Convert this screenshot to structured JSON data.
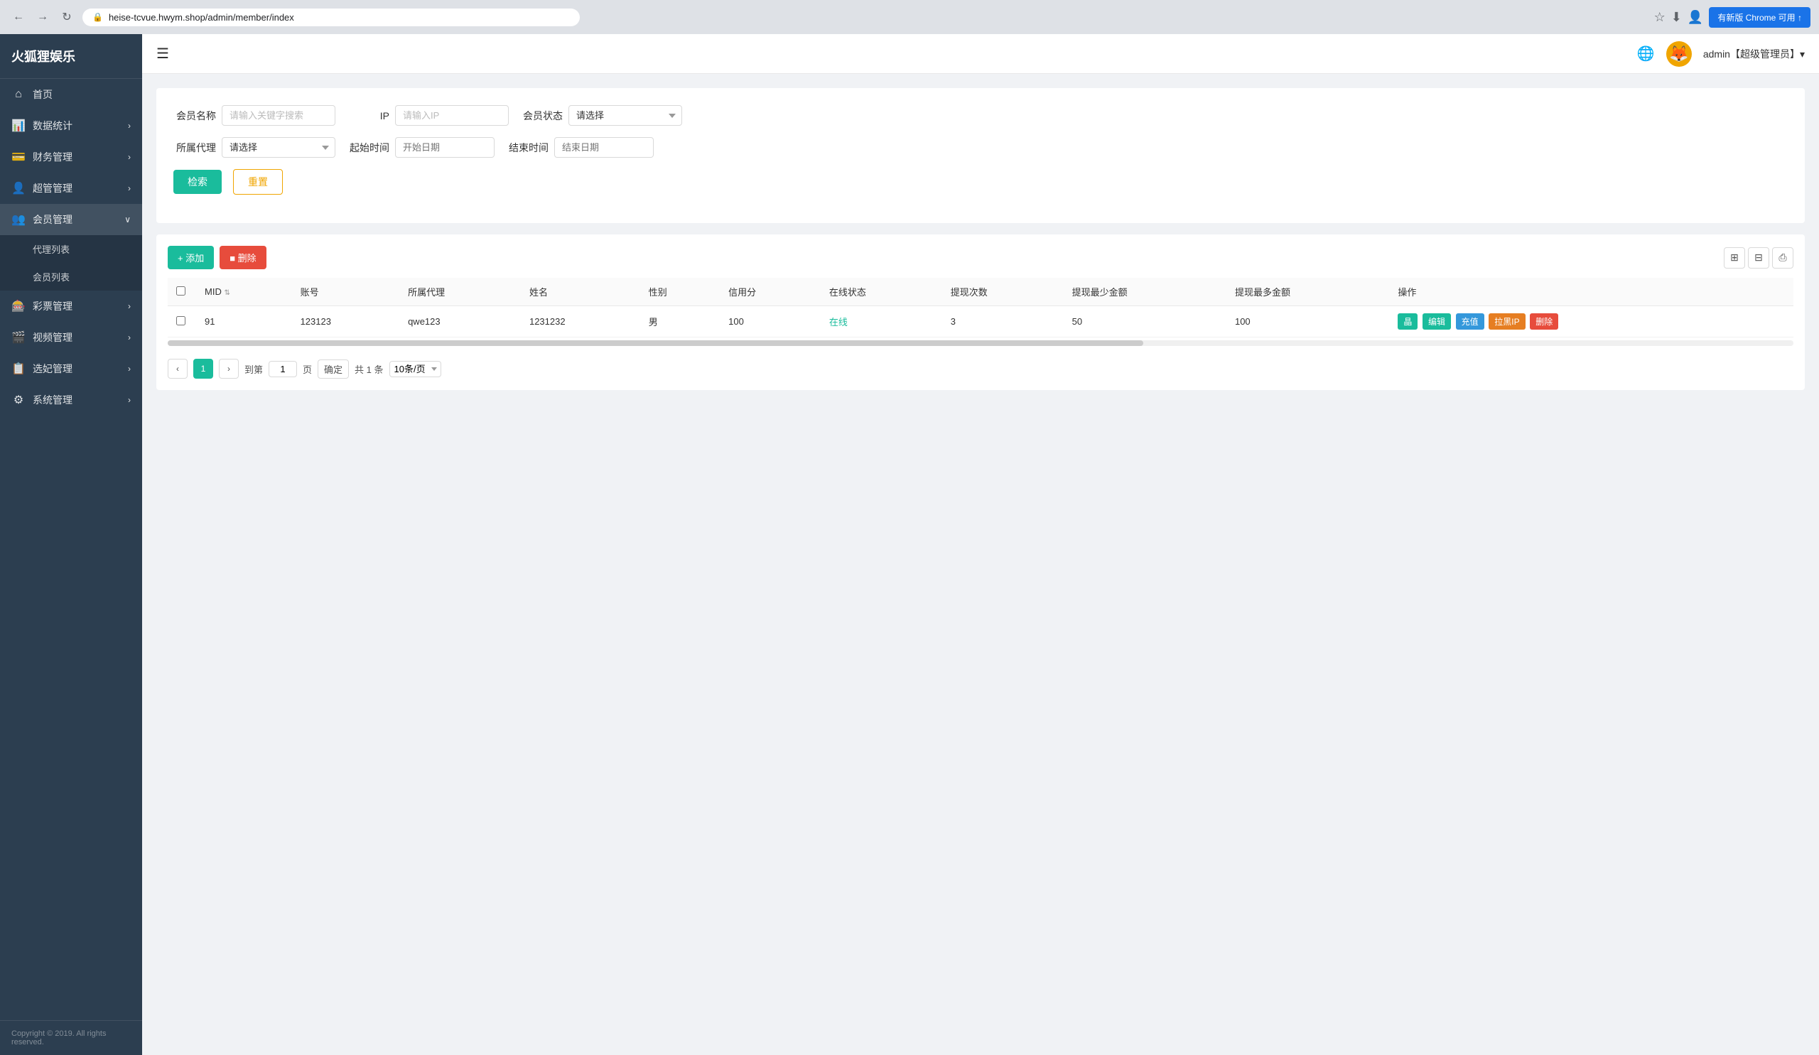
{
  "browser": {
    "url": "heise-tcvue.hwym.shop/admin/member/index",
    "update_btn": "有新版 Chrome 可用 ↑"
  },
  "sidebar": {
    "logo": "火狐狸娱乐",
    "menu_icon": "☰",
    "items": [
      {
        "id": "home",
        "icon": "⌂",
        "label": "首页",
        "hasArrow": false,
        "hasSubmenu": false
      },
      {
        "id": "data-stats",
        "icon": "📊",
        "label": "数据统计",
        "hasArrow": true,
        "hasSubmenu": false
      },
      {
        "id": "finance",
        "icon": "💳",
        "label": "财务管理",
        "hasArrow": true,
        "hasSubmenu": false
      },
      {
        "id": "super-admin",
        "icon": "👤",
        "label": "超管管理",
        "hasArrow": true,
        "hasSubmenu": false
      },
      {
        "id": "member-mgmt",
        "icon": "👥",
        "label": "会员管理",
        "hasArrow": true,
        "hasSubmenu": true,
        "submenu": [
          "代理列表",
          "会员列表"
        ]
      },
      {
        "id": "lottery",
        "icon": "🎰",
        "label": "彩票管理",
        "hasArrow": true,
        "hasSubmenu": false
      },
      {
        "id": "video",
        "icon": "🎬",
        "label": "视频管理",
        "hasArrow": true,
        "hasSubmenu": false
      },
      {
        "id": "election",
        "icon": "📋",
        "label": "选妃管理",
        "hasArrow": true,
        "hasSubmenu": false
      },
      {
        "id": "system",
        "icon": "⚙",
        "label": "系统管理",
        "hasArrow": true,
        "hasSubmenu": false
      }
    ],
    "footer": "Copyright © 2019. All rights reserved."
  },
  "header": {
    "user_label": "admin【超级管理员】▾"
  },
  "search": {
    "member_name_label": "会员名称",
    "member_name_placeholder": "请输入关键字搜索",
    "ip_label": "IP",
    "ip_placeholder": "请输入IP",
    "status_label": "会员状态",
    "status_placeholder": "请选择",
    "agent_label": "所属代理",
    "agent_placeholder": "请选择",
    "start_label": "起始时间",
    "start_placeholder": "开始日期",
    "end_label": "结束时间",
    "end_placeholder": "结束日期",
    "search_btn": "检索",
    "reset_btn": "重置"
  },
  "table": {
    "add_btn": "+ 添加",
    "delete_btn": "■ 删除",
    "columns": [
      "MID",
      "账号",
      "所属代理",
      "姓名",
      "性别",
      "信用分",
      "在线状态",
      "提现次数",
      "提现最少金额",
      "提现最多金额",
      "操作"
    ],
    "rows": [
      {
        "mid": "91",
        "account": "123123",
        "agent": "qwe123",
        "name": "1231232",
        "gender": "男",
        "credit": "100",
        "online_status": "在线",
        "withdraw_count": "3",
        "withdraw_min": "50",
        "withdraw_max": "100",
        "ops": [
          "晶",
          "编辑",
          "充值",
          "拉黑IP",
          "删除"
        ]
      }
    ],
    "pagination": {
      "current": "1",
      "goto_label": "到第",
      "page_label": "页",
      "confirm_label": "确定",
      "total_label": "共 1 条",
      "per_page": "10条/页"
    }
  }
}
